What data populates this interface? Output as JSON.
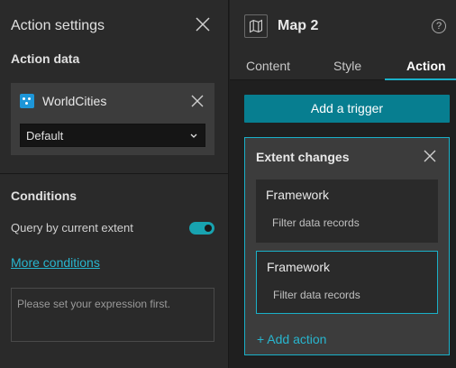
{
  "left_panel": {
    "title": "Action settings",
    "action_data_title": "Action data",
    "data_source": {
      "name": "WorldCities",
      "selected_view": "Default"
    },
    "conditions_title": "Conditions",
    "query_label": "Query by current extent",
    "query_enabled": true,
    "more_conditions_label": "More conditions",
    "expression_placeholder": "Please set your expression first."
  },
  "right_panel": {
    "title": "Map 2",
    "help_glyph": "?",
    "tabs": [
      {
        "label": "Content",
        "active": false
      },
      {
        "label": "Style",
        "active": false
      },
      {
        "label": "Action",
        "active": true
      }
    ],
    "add_trigger_label": "Add a trigger",
    "trigger": {
      "title": "Extent changes",
      "actions": [
        {
          "name": "Framework",
          "description": "Filter data records",
          "selected": false
        },
        {
          "name": "Framework",
          "description": "Filter data records",
          "selected": true
        }
      ],
      "add_action_label": "+ Add action"
    }
  },
  "colors": {
    "accent": "#1ab0c8",
    "button": "#077e90",
    "link": "#28b6cf",
    "panel_bg": "#2a2a2a"
  },
  "icons": [
    "close-icon",
    "datasource-icon",
    "chevron-down-icon",
    "map-icon",
    "help-icon"
  ]
}
